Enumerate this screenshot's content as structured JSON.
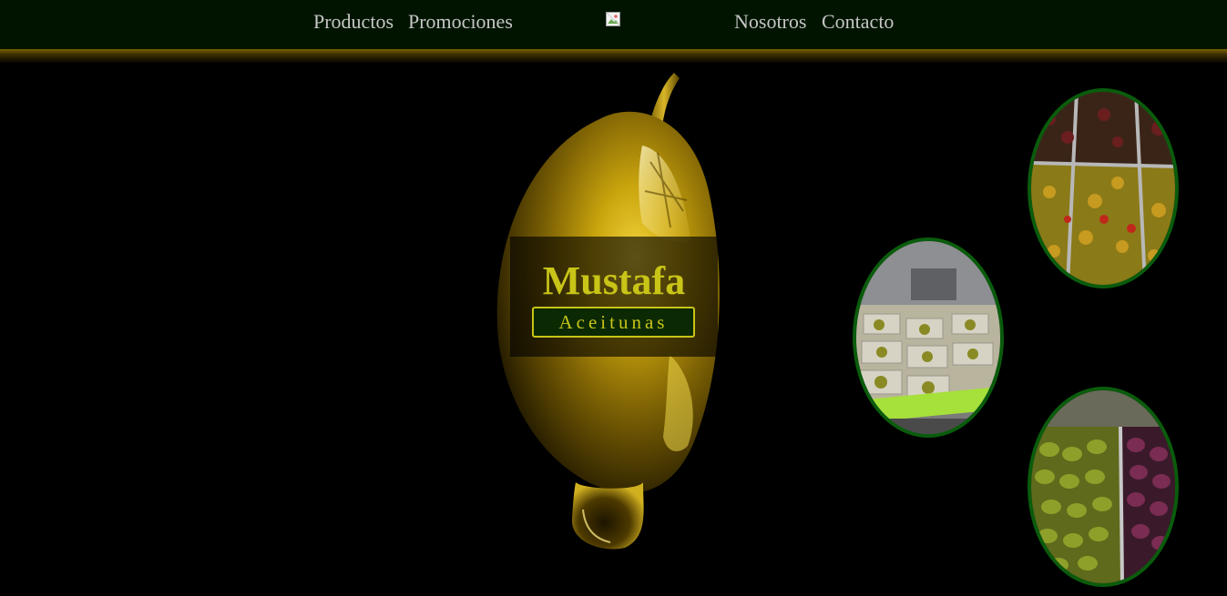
{
  "nav": {
    "items": [
      {
        "label": "Productos"
      },
      {
        "label": "Promociones"
      },
      {
        "label": "Nosotros"
      },
      {
        "label": "Contacto"
      }
    ],
    "logo_icon": "broken-image-icon"
  },
  "hero": {
    "title": "Mustafa",
    "subtitle": "Aceitunas"
  },
  "gallery": {
    "items": [
      {
        "icon": "olive-trays-photo"
      },
      {
        "icon": "market-counter-photo"
      },
      {
        "icon": "green-and-purple-olives-photo"
      }
    ]
  },
  "colors": {
    "background": "#000000",
    "topbar": "#001400",
    "nav_text": "#c6c6c6",
    "accent_yellow": "#c8c418",
    "oval_border": "#0a5c0c",
    "subtitle_bg": "#0b2a04"
  }
}
